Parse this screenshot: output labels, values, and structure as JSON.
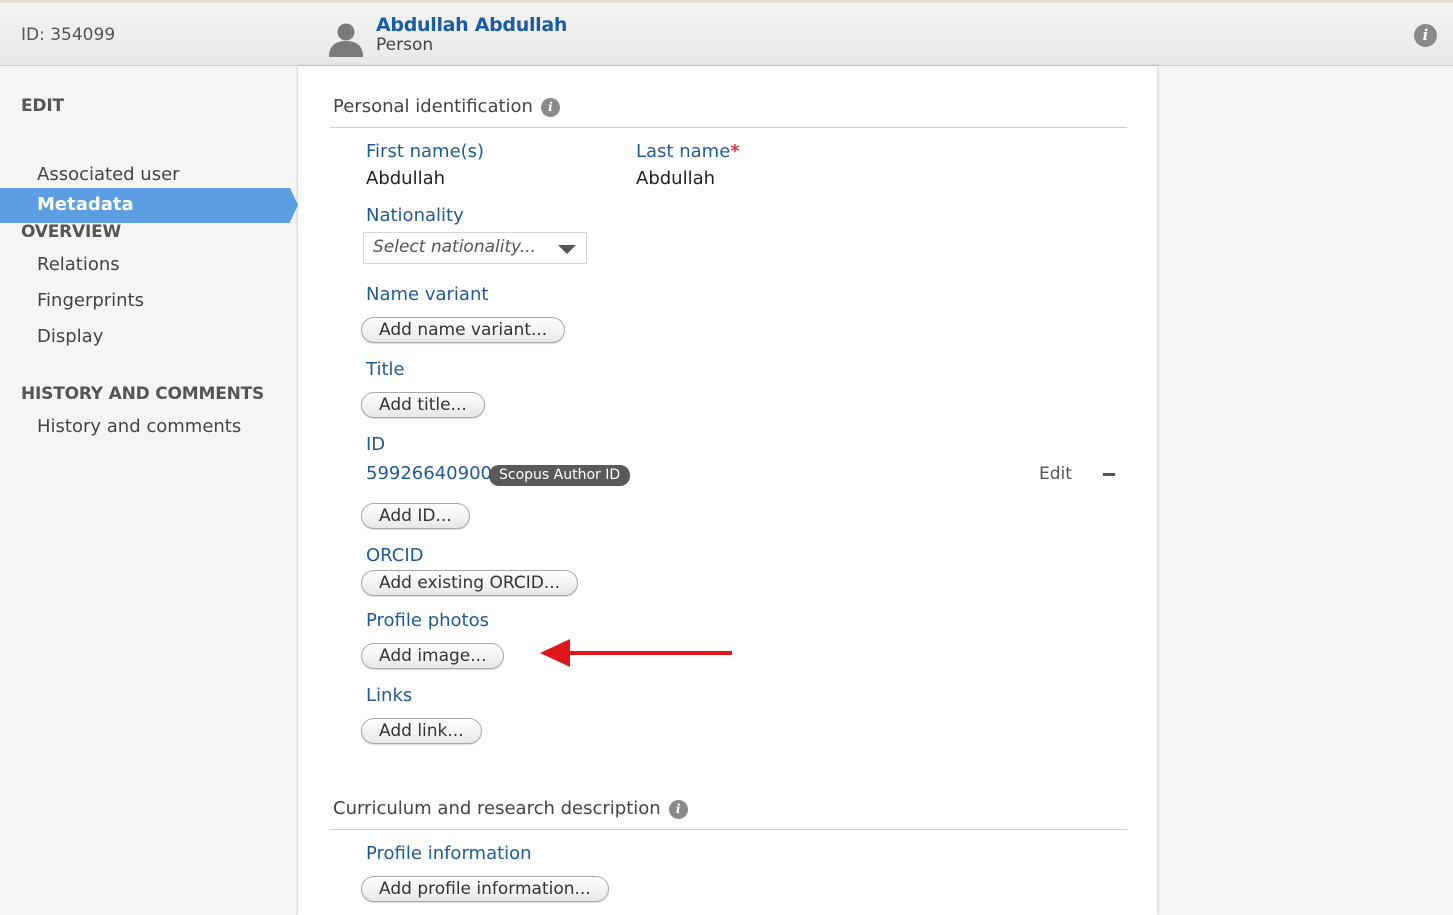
{
  "header": {
    "record_id": "ID: 354099",
    "name": "Abdullah Abdullah",
    "type": "Person",
    "info_icon": "i"
  },
  "sidebar": {
    "edit_title": "EDIT",
    "edit_items": [
      {
        "label": "Metadata",
        "active": true
      },
      {
        "label": "Associated user",
        "active": false
      }
    ],
    "overview_title": "OVERVIEW",
    "overview_items": [
      {
        "label": "Relations"
      },
      {
        "label": "Fingerprints"
      },
      {
        "label": "Display"
      }
    ],
    "history_title": "HISTORY AND COMMENTS",
    "history_items": [
      {
        "label": "History and comments"
      }
    ]
  },
  "personal": {
    "title": "Personal identification",
    "help_icon": "i",
    "first_name_label": "First name(s)",
    "first_name_value": "Abdullah",
    "last_name_label": "Last name",
    "required_mark": "*",
    "last_name_value": "Abdullah",
    "nationality_label": "Nationality",
    "nationality_placeholder": "Select nationality...",
    "name_variant_label": "Name variant",
    "name_variant_button": "Add name variant...",
    "title_label": "Title",
    "title_button": "Add title...",
    "id_label": "ID",
    "id_value": "59926640900",
    "id_type": "Scopus Author ID",
    "edit_link": "Edit",
    "id_button": "Add ID...",
    "orcid_label": "ORCID",
    "orcid_button": "Add existing ORCID...",
    "photos_label": "Profile photos",
    "photos_button": "Add image...",
    "links_label": "Links",
    "links_button": "Add link..."
  },
  "curriculum": {
    "title": "Curriculum and research description",
    "help_icon": "i",
    "profile_info_label": "Profile information",
    "profile_info_button": "Add profile information..."
  },
  "annotation": {
    "arrow_color": "#e0161b"
  }
}
